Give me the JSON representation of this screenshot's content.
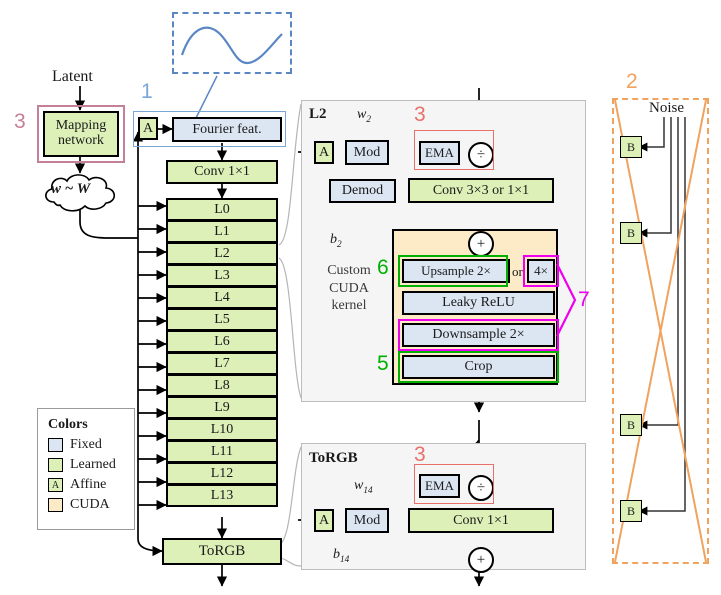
{
  "figure": {
    "title": "StyleGAN3 generator architecture diagram",
    "colors": {
      "fixed": "#dce6f2",
      "learned": "#ddf0b8",
      "affine": "#ddf0b8",
      "cuda": "#fdebc8",
      "ann_pink": "#c47f99",
      "ann_blue": "#7ba7d7",
      "ann_red": "#e8706a",
      "ann_green": "#00b000",
      "ann_magenta": "#ee00ee",
      "ann_orange": "#f0a35e",
      "panel_bg": "#f5f5f5",
      "sine_stroke": "#5b86c4"
    }
  },
  "legend": {
    "title": "Colors",
    "items": [
      {
        "label": "Fixed",
        "swatch": "fixed",
        "glyph": ""
      },
      {
        "label": "Learned",
        "swatch": "learned",
        "glyph": ""
      },
      {
        "label": "Affine",
        "swatch": "affine",
        "glyph": "A"
      },
      {
        "label": "CUDA",
        "swatch": "cuda",
        "glyph": ""
      }
    ]
  },
  "mapping": {
    "latent_label": "Latent",
    "network_label_line1": "Mapping",
    "network_label_line2": "network",
    "w_cloud_label": "w ~ W",
    "annotation": "3"
  },
  "input_branch": {
    "annotation": "1",
    "affine_label": "A",
    "fourier_label": "Fourier feat.",
    "conv_label": "Conv 1×1",
    "sine_icon": "sine-wave"
  },
  "layer_stack": {
    "layers": [
      "L0",
      "L1",
      "L2",
      "L3",
      "L4",
      "L5",
      "L6",
      "L7",
      "L8",
      "L9",
      "L10",
      "L11",
      "L12",
      "L13"
    ],
    "torgb_label": "ToRGB"
  },
  "l2_panel": {
    "title": "L2",
    "w_label": "w",
    "w_sub": "2",
    "b_label": "b",
    "b_sub": "2",
    "affine_label": "A",
    "mod_label": "Mod",
    "demod_label": "Demod",
    "ema_label": "EMA",
    "divide_glyph": "÷",
    "plus_glyph": "+",
    "conv_label": "Conv 3×3 or 1×1",
    "cuda_label_line1": "Custom",
    "cuda_label_line2": "CUDA",
    "cuda_label_line3": "kernel",
    "upsample_label": "Upsample 2×",
    "upsample_or": "or",
    "upsample_alt": "4×",
    "relu_label": "Leaky ReLU",
    "downsample_label": "Downsample 2×",
    "crop_label": "Crop",
    "ann_ema": "3",
    "ann_upsample": "6",
    "ann_crop": "5",
    "ann_resample": "7"
  },
  "torgb_panel": {
    "title": "ToRGB",
    "w_label": "w",
    "w_sub": "14",
    "b_label": "b",
    "b_sub": "14",
    "affine_label": "A",
    "mod_label": "Mod",
    "ema_label": "EMA",
    "divide_glyph": "÷",
    "plus_glyph": "+",
    "conv_label": "Conv 1×1",
    "ann_ema": "3"
  },
  "noise_panel": {
    "annotation": "2",
    "title": "Noise",
    "b_boxes": [
      "B",
      "B",
      "B",
      "B"
    ],
    "struck_out": true
  }
}
